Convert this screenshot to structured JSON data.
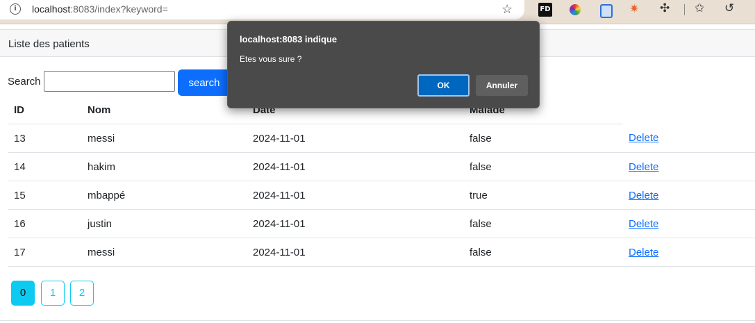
{
  "browser": {
    "url_host": "localhost",
    "url_rest": ":8083/index?keyword=",
    "extensions": [
      "FD",
      "color-wheel-icon",
      "copy-icon",
      "spark-icon",
      "puzzle-icon",
      "favorites-icon",
      "history-icon"
    ]
  },
  "page": {
    "title": "Liste des patients",
    "search_label": "Search",
    "search_value": "",
    "search_button": "search",
    "columns": [
      "ID",
      "Nom",
      "Date",
      "Malade"
    ],
    "rows": [
      {
        "id": "13",
        "nom": "messi",
        "date": "2024-11-01",
        "malade": "false",
        "action": "Delete"
      },
      {
        "id": "14",
        "nom": "hakim",
        "date": "2024-11-01",
        "malade": "false",
        "action": "Delete"
      },
      {
        "id": "15",
        "nom": "mbappé",
        "date": "2024-11-01",
        "malade": "true",
        "action": "Delete"
      },
      {
        "id": "16",
        "nom": "justin",
        "date": "2024-11-01",
        "malade": "false",
        "action": "Delete"
      },
      {
        "id": "17",
        "nom": "messi",
        "date": "2024-11-01",
        "malade": "false",
        "action": "Delete"
      }
    ],
    "pages": [
      "0",
      "1",
      "2"
    ],
    "active_page": "0"
  },
  "dialog": {
    "title": "localhost:8083 indique",
    "message": "Etes vous sure ?",
    "ok": "OK",
    "cancel": "Annuler"
  },
  "colors": {
    "primary": "#0d6efd",
    "info": "#0dcaf0",
    "dialog_bg": "#4a4a4a",
    "dialog_ok": "#0067c0"
  }
}
